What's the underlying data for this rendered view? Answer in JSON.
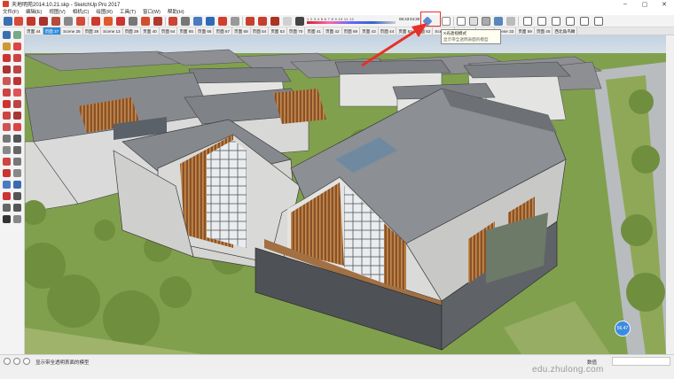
{
  "window": {
    "title": "天地明苑2014.10.21.skp - SketchUp Pro 2017",
    "minimize_icon": "minimize-icon",
    "maximize_icon": "maximize-icon",
    "close_icon": "close-icon"
  },
  "menu": [
    "文件(F)",
    "编辑(E)",
    "视图(V)",
    "相机(C)",
    "绘图(R)",
    "工具(T)",
    "窗口(W)",
    "帮助(H)"
  ],
  "shadow_bar": {
    "tick_labels": "1 2 3 4 5 6 7 8 9 10 11 12",
    "time_left": "06:43",
    "time_right": "04:30",
    "time_end": "下午"
  },
  "tabs": [
    "页面 44",
    "页面 37",
    "Scene 25",
    "页面 38",
    "Scene 13",
    "页面 39",
    "页面 40",
    "页面 64",
    "页面 65",
    "页面 66",
    "页面 67",
    "页面 68",
    "页面 54",
    "页面 53",
    "页面 70",
    "页面 41",
    "页面 42",
    "页面 69",
    "页面 43",
    "页面 44",
    "页面 62",
    "页面 62",
    "Scene 22",
    "Scene 23",
    "页面 57",
    "Scene 33",
    "页面 59",
    "页面 45",
    "西北角鸟瞰"
  ],
  "active_tab_index": 1,
  "tooltip": {
    "title": "X光透视模式",
    "subtitle": "显示带全透明表面的模型"
  },
  "badge": "56.47",
  "status": {
    "message": "显示带全透明表面的模型",
    "measurements_label": "数值"
  },
  "watermark": "edu.zhulong.com",
  "colors": {
    "accent": "#2e8bd8",
    "highlight": "#e8302a",
    "sky": "#c9d7e6"
  }
}
